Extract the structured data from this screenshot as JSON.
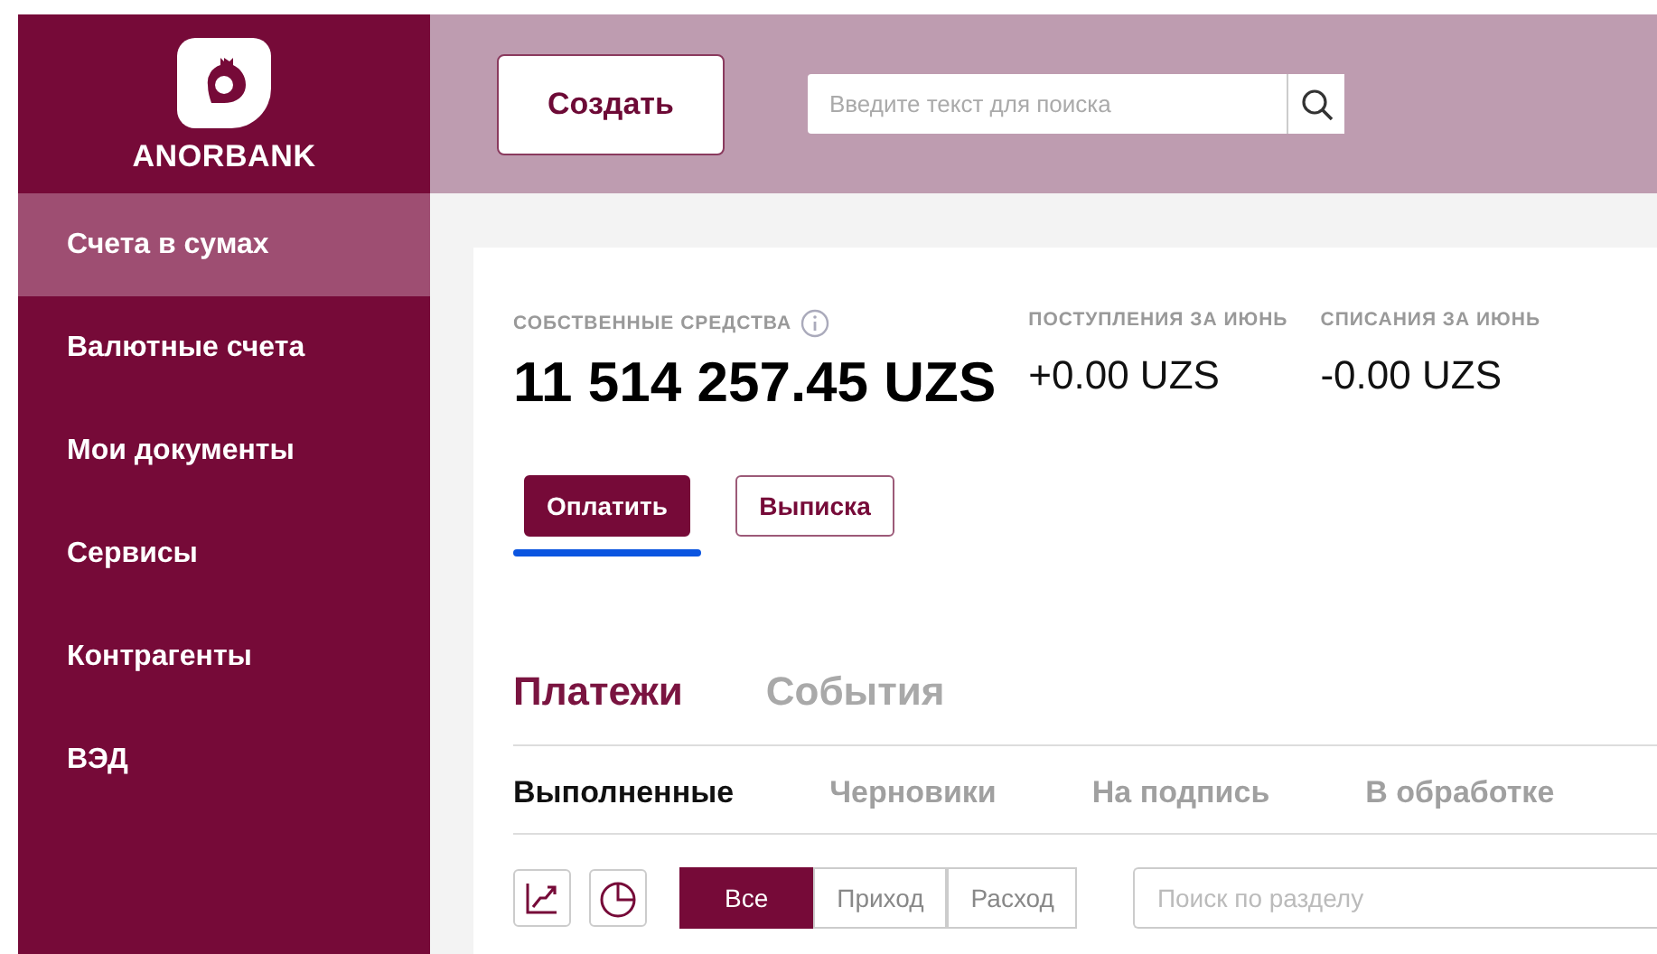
{
  "brand": {
    "name": "ANORBANK"
  },
  "sidebar": {
    "items": [
      {
        "label": "Счета в сумах",
        "selected": true
      },
      {
        "label": "Валютные счета",
        "selected": false
      },
      {
        "label": "Мои документы",
        "selected": false
      },
      {
        "label": "Сервисы",
        "selected": false
      },
      {
        "label": "Контрагенты",
        "selected": false
      },
      {
        "label": "ВЭД",
        "selected": false
      }
    ]
  },
  "header": {
    "create_button": "Создать",
    "search": {
      "placeholder": "Введите текст для поиска"
    }
  },
  "summary": {
    "stats": [
      {
        "label": "СОБСТВЕННЫЕ СРЕДСТВА",
        "value": "11 514 257.45 UZS",
        "kind": "main"
      },
      {
        "label": "ПОСТУПЛЕНИЯ ЗА ИЮНЬ",
        "value": "+0.00 UZS",
        "kind": "plain"
      },
      {
        "label": "СПИСАНИЯ ЗА ИЮНЬ",
        "value": "-0.00 UZS",
        "kind": "plain"
      }
    ],
    "actions": [
      {
        "label": "Оплатить",
        "kind": "primary",
        "focused": true
      },
      {
        "label": "Выписка",
        "kind": "outline",
        "focused": false
      }
    ]
  },
  "tabs": [
    {
      "label": "Платежи",
      "selected": true
    },
    {
      "label": "События",
      "selected": false
    }
  ],
  "subtabs": [
    {
      "label": "Выполненные",
      "selected": true
    },
    {
      "label": "Черновики",
      "selected": false
    },
    {
      "label": "На подпись",
      "selected": false
    },
    {
      "label": "В обработке",
      "selected": false
    }
  ],
  "filters": [
    {
      "label": "Все",
      "selected": true
    },
    {
      "label": "Приход",
      "selected": false
    },
    {
      "label": "Расход",
      "selected": false
    }
  ],
  "section_search": {
    "placeholder": "Поиск по разделу"
  }
}
